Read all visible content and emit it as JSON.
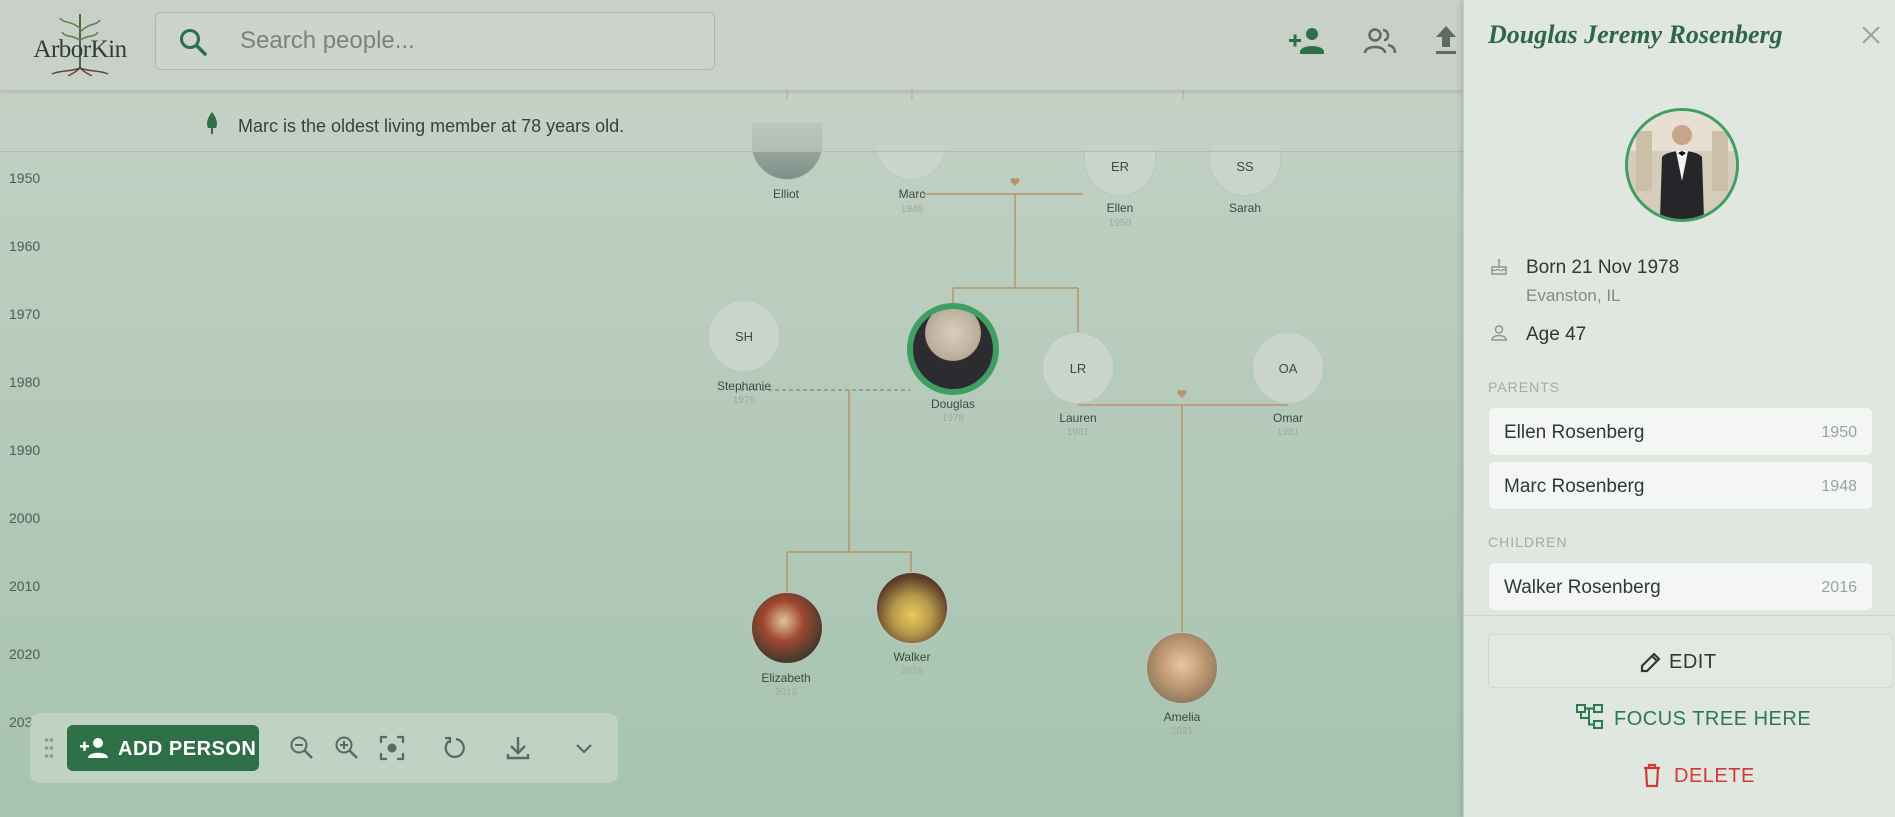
{
  "app": {
    "logo_text": "ArborKin"
  },
  "search": {
    "placeholder": "Search people..."
  },
  "info_banner": {
    "text": "Marc is the oldest living member at 78 years old."
  },
  "timeline": {
    "years": [
      "1950",
      "1960",
      "1970",
      "1980",
      "1990",
      "2000",
      "2010",
      "2020",
      "203"
    ]
  },
  "tree": {
    "people": [
      {
        "name": "Elliot",
        "year": "",
        "initials": "",
        "photo": true
      },
      {
        "name": "Marc",
        "year": "1948",
        "initials": "",
        "photo": false
      },
      {
        "name": "Ellen",
        "year": "1950",
        "initials": "ER",
        "photo": false
      },
      {
        "name": "Sarah",
        "year": "",
        "initials": "SS",
        "photo": false
      },
      {
        "name": "Stephanie",
        "year": "1976",
        "initials": "SH",
        "photo": false
      },
      {
        "name": "Douglas",
        "year": "1978",
        "initials": "",
        "photo": true,
        "selected": true
      },
      {
        "name": "Lauren",
        "year": "1981",
        "initials": "LR",
        "photo": false
      },
      {
        "name": "Omar",
        "year": "1981",
        "initials": "OA",
        "photo": false
      },
      {
        "name": "Elizabeth",
        "year": "2013",
        "initials": "",
        "photo": true
      },
      {
        "name": "Walker",
        "year": "2016",
        "initials": "",
        "photo": true
      },
      {
        "name": "Amelia",
        "year": "2021",
        "initials": "",
        "photo": true
      }
    ]
  },
  "toolbar": {
    "add_person_label": "ADD PERSON",
    "tools": [
      "zoom-out",
      "zoom-in",
      "fit-to-screen",
      "reset",
      "download",
      "expand-more"
    ]
  },
  "panel": {
    "title": "Douglas Jeremy Rosenberg",
    "born": "Born 21 Nov 1978",
    "birthplace": "Evanston, IL",
    "age": "Age 47",
    "parents_heading": "PARENTS",
    "parents": [
      {
        "name": "Ellen Rosenberg",
        "year": "1950"
      },
      {
        "name": "Marc Rosenberg",
        "year": "1948"
      }
    ],
    "children_heading": "CHILDREN",
    "children": [
      {
        "name": "Walker Rosenberg",
        "year": "2016"
      }
    ],
    "edit_label": "EDIT",
    "focus_label": "FOCUS TREE HERE",
    "delete_label": "DELETE"
  },
  "colors": {
    "brand": "#2e6f48",
    "accent_ring": "#3f9e62",
    "danger": "#d23a34",
    "line": "#b89468"
  }
}
